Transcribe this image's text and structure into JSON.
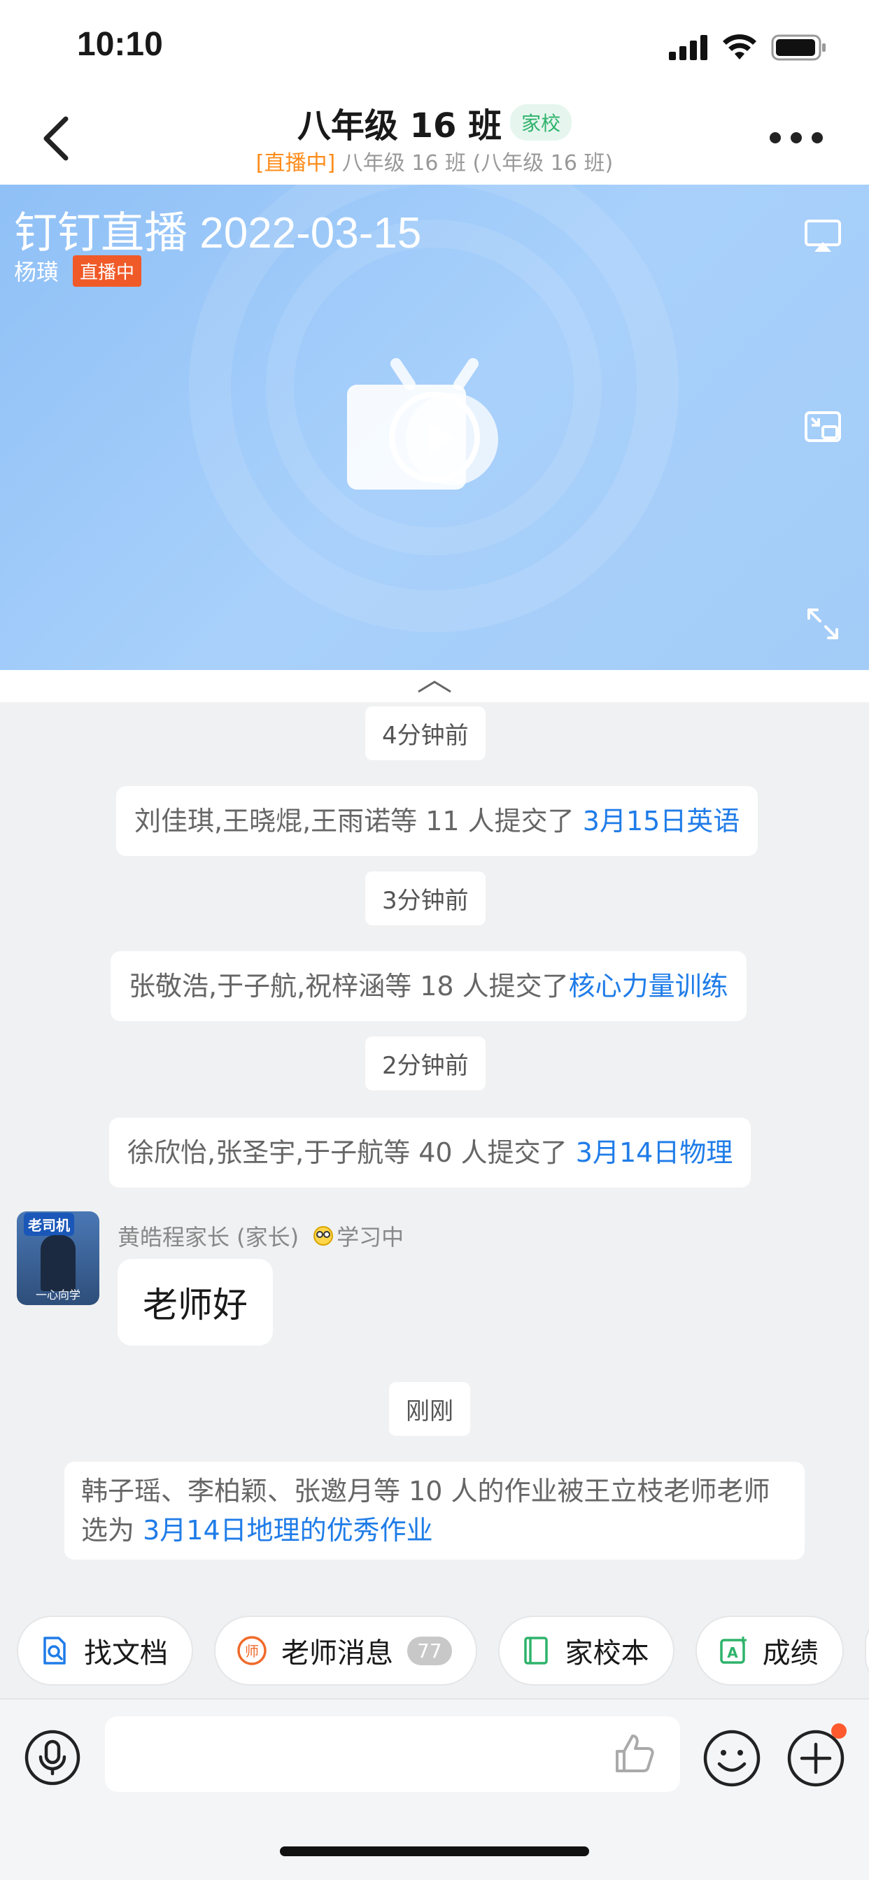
{
  "status": {
    "time": "10:10"
  },
  "nav": {
    "title": "八年级 16 班",
    "tag": "家校",
    "sub_live": "[直播中]",
    "sub_text": " 八年级 16 班 (八年级 16 班)"
  },
  "live": {
    "title": "钉钉直播 2022-03-15",
    "author": "杨璜",
    "badge": "直播中"
  },
  "chat": {
    "time1": "4分钟前",
    "msg1_text": "刘佳琪,王晓焜,王雨诺等 11 人提交了 ",
    "msg1_link": "3月15日英语",
    "time2": "3分钟前",
    "msg2_text": "张敬浩,于子航,祝梓涵等 18 人提交了",
    "msg2_link": "核心力量训练",
    "time3": "2分钟前",
    "msg3_text": "徐欣怡,张圣宇,于子航等 40 人提交了 ",
    "msg3_link": "3月14日物理",
    "sender": "黄皓程家长 (家长)",
    "sender_status": "学习中",
    "avatar_text": "老司机",
    "avatar_caption": "一心向学",
    "bubble": "老师好",
    "time4": "刚刚",
    "msg4_line1": "韩子瑶、李柏颖、张邀月等 10 人的作业被王立枝老师老师",
    "msg4_prefix": "选为 ",
    "msg4_link": "3月14日地理的优秀作业"
  },
  "tools": [
    {
      "label": "找文档",
      "icon": "doc-search-icon"
    },
    {
      "label": "老师消息",
      "icon": "teacher-message-icon",
      "count": "77"
    },
    {
      "label": "家校本",
      "icon": "notebook-icon"
    },
    {
      "label": "成绩",
      "icon": "grade-icon"
    }
  ],
  "input": {
    "placeholder": ""
  },
  "colors": {
    "link": "#1f7ce8",
    "live_orange": "#ff8c1a",
    "badge_red": "#f05a28",
    "tag_green": "#2fb36b"
  }
}
